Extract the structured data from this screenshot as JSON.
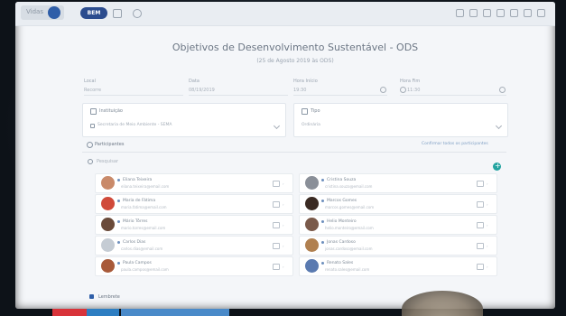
{
  "app": {
    "logo_text": "Vidas",
    "brand_badge": "BEM"
  },
  "page": {
    "title": "Objetivos de Desenvolvimento Sustentável - ODS",
    "subtitle": "(25 de Agosto 2019 às ODS)"
  },
  "fields": {
    "local": {
      "label": "Local",
      "value": "Recorre"
    },
    "data": {
      "label": "Data",
      "value": "08/19/2019"
    },
    "hora_inicio": {
      "label": "Hora Início",
      "value": "19:30"
    },
    "hora_fim": {
      "label": "Hora Fim",
      "value": "11:30"
    }
  },
  "organizacao": {
    "label": "Instituição",
    "value": "Secretaria de Meio Ambiente - SEMA"
  },
  "tipo": {
    "label": "Tipo",
    "value": "Ordinária"
  },
  "participantes": {
    "label": "Participantes",
    "link": "Confirmar todos os participantes",
    "search_placeholder": "Pesquisar"
  },
  "people_left": [
    {
      "name": "Eliana Teixeira",
      "email": "eliana.teixeira@email.com",
      "avatar_color": "#c98a6a"
    },
    {
      "name": "Maria de Fátima",
      "email": "maria.fatima@email.com",
      "avatar_color": "#d04a3a"
    },
    {
      "name": "Mário Tôrres",
      "email": "mario.torres@email.com",
      "avatar_color": "#6a4a3a"
    },
    {
      "name": "Carlos Dias",
      "email": "carlos.dias@email.com",
      "avatar_color": "#c5ccd4"
    },
    {
      "name": "Paula Campos",
      "email": "paula.campos@email.com",
      "avatar_color": "#a85a3a"
    }
  ],
  "people_right": [
    {
      "name": "Cristina Souza",
      "email": "cristina.souza@email.com",
      "avatar_color": "#8a8f98"
    },
    {
      "name": "Marcos Gomes",
      "email": "marcos.gomes@email.com",
      "avatar_color": "#3a2a22"
    },
    {
      "name": "Helio Monteiro",
      "email": "helio.monteiro@email.com",
      "avatar_color": "#7a5a4a"
    },
    {
      "name": "Jonas Cardoso",
      "email": "jonas.cardoso@email.com",
      "avatar_color": "#b08050"
    },
    {
      "name": "Renato Sales",
      "email": "renato.sales@email.com",
      "avatar_color": "#5a7ab0"
    }
  ],
  "footer": {
    "lembrete": "Lembrete"
  }
}
